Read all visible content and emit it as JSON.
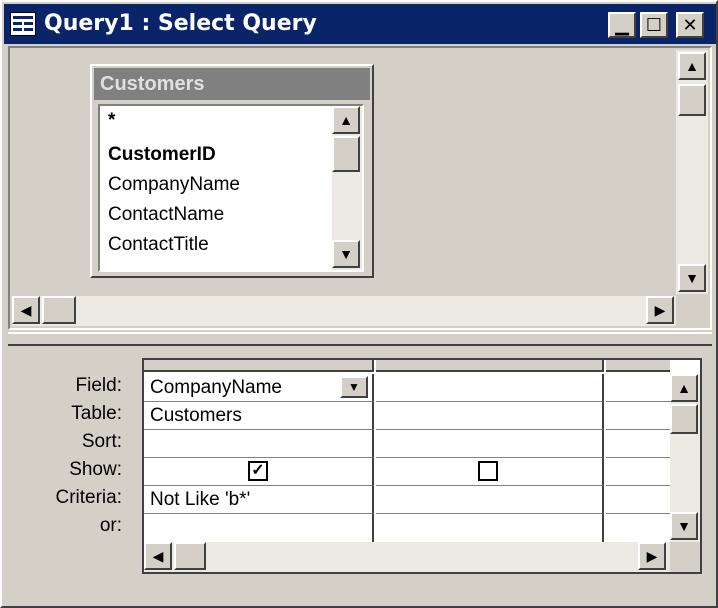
{
  "window": {
    "title": "Query1 : Select Query",
    "app_icon": "query-icon",
    "buttons": {
      "minimize": "▁",
      "maximize": "☐",
      "close": "✕"
    }
  },
  "table_box": {
    "title": "Customers",
    "fields": [
      {
        "label": "*",
        "bold": true
      },
      {
        "label": "CustomerID",
        "bold": true
      },
      {
        "label": "CompanyName",
        "bold": false
      },
      {
        "label": "ContactName",
        "bold": false
      },
      {
        "label": "ContactTitle",
        "bold": false
      }
    ]
  },
  "grid": {
    "row_labels": [
      "Field:",
      "Table:",
      "Sort:",
      "Show:",
      "Criteria:",
      "or:"
    ],
    "columns": [
      {
        "field": "CompanyName",
        "table": "Customers",
        "sort": "",
        "show": true,
        "criteria": "Not Like 'b*'",
        "or": ""
      },
      {
        "field": "",
        "table": "",
        "sort": "",
        "show": false,
        "criteria": "",
        "or": ""
      },
      {
        "field": "",
        "table": "",
        "sort": "",
        "show": false,
        "criteria": "",
        "or": ""
      }
    ]
  },
  "glyphs": {
    "up": "▲",
    "down": "▼",
    "left": "◀",
    "right": "▶",
    "check": "✓",
    "dropdown": "▼"
  },
  "colors": {
    "titlebar": "#0a246a",
    "table_titlebar": "#808080",
    "face": "#d4d0c8"
  }
}
